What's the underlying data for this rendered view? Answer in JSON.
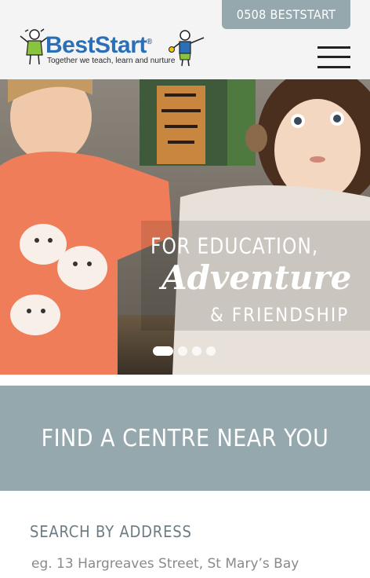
{
  "header": {
    "phone_label": "0508 BESTSTART",
    "brand_name": "BestStart",
    "brand_reg": "®",
    "tagline": "Together we teach, learn and nurture"
  },
  "hero": {
    "line1": "FOR EDUCATION,",
    "line2": "Adventure",
    "line3": "& FRIENDSHIP",
    "slides": 4,
    "active_slide": 1
  },
  "find_centre": {
    "title": "FIND A CENTRE NEAR YOU"
  },
  "search": {
    "label": "SEARCH BY ADDRESS",
    "placeholder": "eg. 13 Hargreaves Street, St Mary’s Bay",
    "value": ""
  },
  "colors": {
    "accent": "#95a8ad",
    "brand_blue": "#2b6fb7",
    "header_bg": "#f4f4f4"
  }
}
